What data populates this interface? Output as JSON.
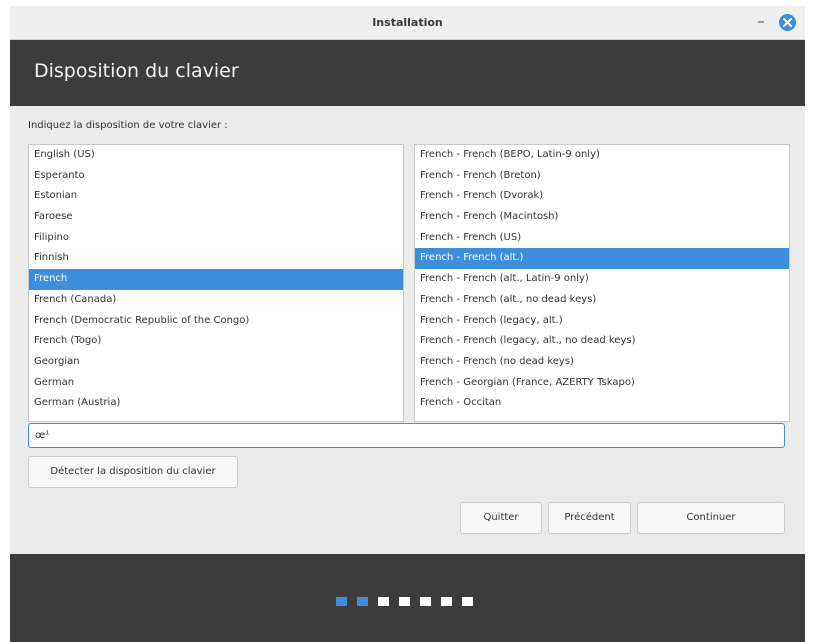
{
  "window": {
    "title": "Installation",
    "minimize_glyph": "–",
    "close_icon": "close-icon"
  },
  "header": {
    "title": "Disposition du clavier"
  },
  "prompt": "Indiquez la disposition de votre clavier :",
  "layouts": {
    "items": [
      "English (US)",
      "Esperanto",
      "Estonian",
      "Faroese",
      "Filipino",
      "Finnish",
      "French",
      "French (Canada)",
      "French (Democratic Republic of the Congo)",
      "French (Togo)",
      "Georgian",
      "German",
      "German (Austria)"
    ],
    "selected": "French"
  },
  "variants": {
    "items": [
      "French - French (BEPO, Latin-9 only)",
      "French - French (Breton)",
      "French - French (Dvorak)",
      "French - French (Macintosh)",
      "French - French (US)",
      "French - French (alt.)",
      "French - French (alt., Latin-9 only)",
      "French - French (alt., no dead keys)",
      "French - French (legacy, alt.)",
      "French - French (legacy, alt., no dead keys)",
      "French - French (no dead keys)",
      "French - Georgian (France, AZERTY Tskapo)",
      "French - Occitan"
    ],
    "selected": "French - French (alt.)"
  },
  "test_input": {
    "value": "œ¹"
  },
  "buttons": {
    "detect": "Détecter la disposition du clavier",
    "quit": "Quitter",
    "previous": "Précédent",
    "continue": "Continuer"
  },
  "progress": {
    "total_steps": 7,
    "completed_steps": 2
  },
  "colors": {
    "accent": "#3d8fdb",
    "header_bg": "#3c3c3c"
  }
}
